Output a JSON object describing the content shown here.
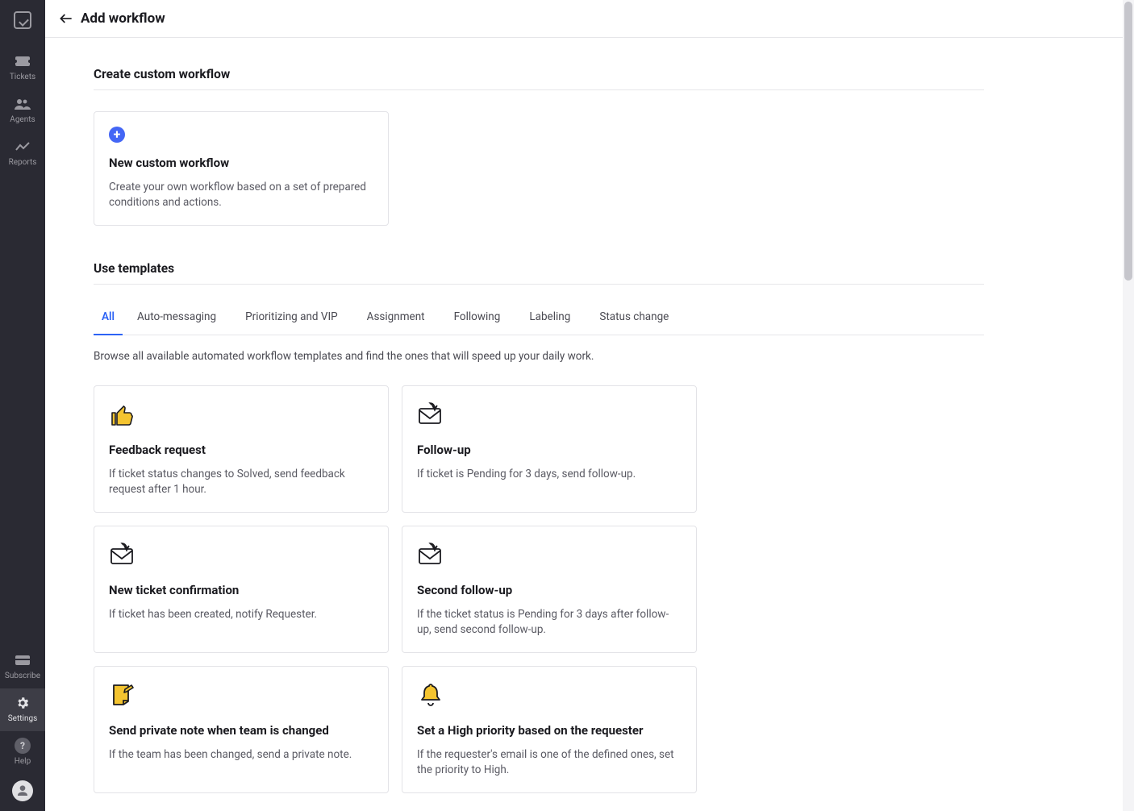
{
  "sidebar": {
    "top": [
      {
        "id": "tickets",
        "label": "Tickets"
      },
      {
        "id": "agents",
        "label": "Agents"
      },
      {
        "id": "reports",
        "label": "Reports"
      }
    ],
    "bottom": [
      {
        "id": "subscribe",
        "label": "Subscribe"
      },
      {
        "id": "settings",
        "label": "Settings",
        "active": true
      },
      {
        "id": "help",
        "label": "Help"
      }
    ]
  },
  "header": {
    "title": "Add workflow"
  },
  "custom_workflow": {
    "section_title": "Create custom workflow",
    "card_title": "New custom workflow",
    "card_desc": "Create your own workflow based on a set of prepared conditions and actions."
  },
  "templates": {
    "section_title": "Use templates",
    "tabs": [
      "All",
      "Auto-messaging",
      "Prioritizing and VIP",
      "Assignment",
      "Following",
      "Labeling",
      "Status change"
    ],
    "active_tab": 0,
    "description": "Browse all available automated workflow templates and find the ones that will speed up your daily work.",
    "cards": [
      {
        "icon": "thumb",
        "title": "Feedback request",
        "desc": "If ticket status changes to Solved, send feedback request after 1 hour."
      },
      {
        "icon": "envelope",
        "title": "Follow-up",
        "desc": "If ticket is Pending for 3 days, send follow-up."
      },
      {
        "icon": "envelope",
        "title": "New ticket confirmation",
        "desc": "If ticket has been created, notify Requester."
      },
      {
        "icon": "envelope",
        "title": "Second follow-up",
        "desc": "If the ticket status is Pending for 3 days after follow-up, send second follow-up."
      },
      {
        "icon": "note",
        "title": "Send private note when team is changed",
        "desc": "If the team has been changed, send a private note."
      },
      {
        "icon": "bell",
        "title": "Set a High priority based on the requester",
        "desc": "If the requester's email is one of the defined ones, set the priority to High."
      }
    ]
  }
}
